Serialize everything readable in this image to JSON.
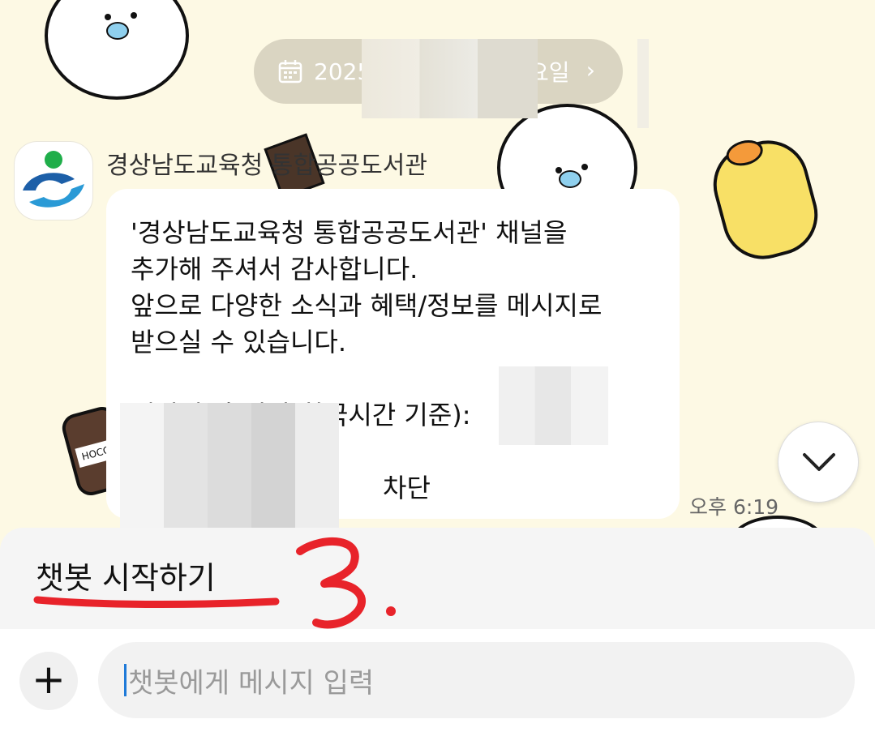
{
  "date_divider": {
    "text": "2025",
    "suffix": "요일"
  },
  "sender": {
    "name": "경상남도교육청 통합공공도서관"
  },
  "message": {
    "lines": [
      "'경상남도교육청 통합공공도서관' 채널을",
      "추가해 주셔서 감사합니다.",
      "앞으로 다양한 소식과 혜택/정보를 메시지로",
      "받으실 수 있습니다.",
      "",
      "채널 추가 일시(한국시간 기준):",
      "",
      "      차단"
    ],
    "time": "오후 6:19"
  },
  "quick_reply": {
    "label": "챗봇 시작하기"
  },
  "annotation": {
    "mark": "3."
  },
  "input": {
    "placeholder": "챗봇에게 메시지 입력",
    "plus_label": "+"
  },
  "icons": [
    "calendar-icon",
    "chevron-right-icon",
    "chevron-down-icon",
    "plus-icon",
    "library-logo-icon"
  ],
  "colors": {
    "background": "#fdf9e4",
    "pill": "#dad5c2",
    "annotation_red": "#e8232a",
    "caret": "#1f7ad8"
  }
}
